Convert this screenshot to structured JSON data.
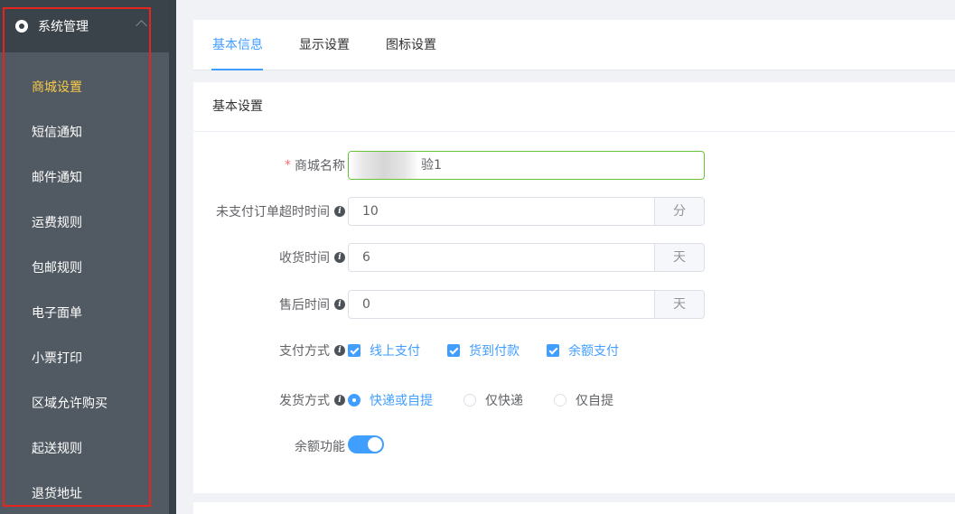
{
  "sidebar": {
    "header": {
      "title": "系统管理",
      "icon": "gear-icon",
      "chevron": "chevron-up-icon"
    },
    "items": [
      {
        "label": "商城设置",
        "active": true
      },
      {
        "label": "短信通知"
      },
      {
        "label": "邮件通知"
      },
      {
        "label": "运费规则"
      },
      {
        "label": "包邮规则"
      },
      {
        "label": "电子面单"
      },
      {
        "label": "小票打印"
      },
      {
        "label": "区域允许购买"
      },
      {
        "label": "起送规则"
      },
      {
        "label": "退货地址"
      }
    ]
  },
  "tabs": [
    {
      "label": "基本信息",
      "active": true
    },
    {
      "label": "显示设置"
    },
    {
      "label": "图标设置"
    }
  ],
  "section": {
    "title": "基本设置"
  },
  "form": {
    "mall_name": {
      "label": "商城名称",
      "required": true,
      "value_visible": "验1"
    },
    "unpaid_timeout": {
      "label": "未支付订单超时时间",
      "value": "10",
      "unit": "分"
    },
    "receive_time": {
      "label": "收货时间",
      "value": "6",
      "unit": "天"
    },
    "aftersale_time": {
      "label": "售后时间",
      "value": "0",
      "unit": "天"
    },
    "payment": {
      "label": "支付方式",
      "options": [
        {
          "label": "线上支付",
          "checked": true
        },
        {
          "label": "货到付款",
          "checked": true
        },
        {
          "label": "余额支付",
          "checked": true
        }
      ]
    },
    "delivery": {
      "label": "发货方式",
      "options": [
        {
          "label": "快递或自提",
          "selected": true
        },
        {
          "label": "仅快递",
          "selected": false
        },
        {
          "label": "仅自提",
          "selected": false
        }
      ]
    },
    "balance": {
      "label": "余额功能",
      "enabled": true
    }
  },
  "colors": {
    "sidebar": "#515a62",
    "active_menu": "#f7c94a",
    "primary": "#409eff",
    "required": "#f56c6c",
    "highlight_box": "#e5261e"
  }
}
